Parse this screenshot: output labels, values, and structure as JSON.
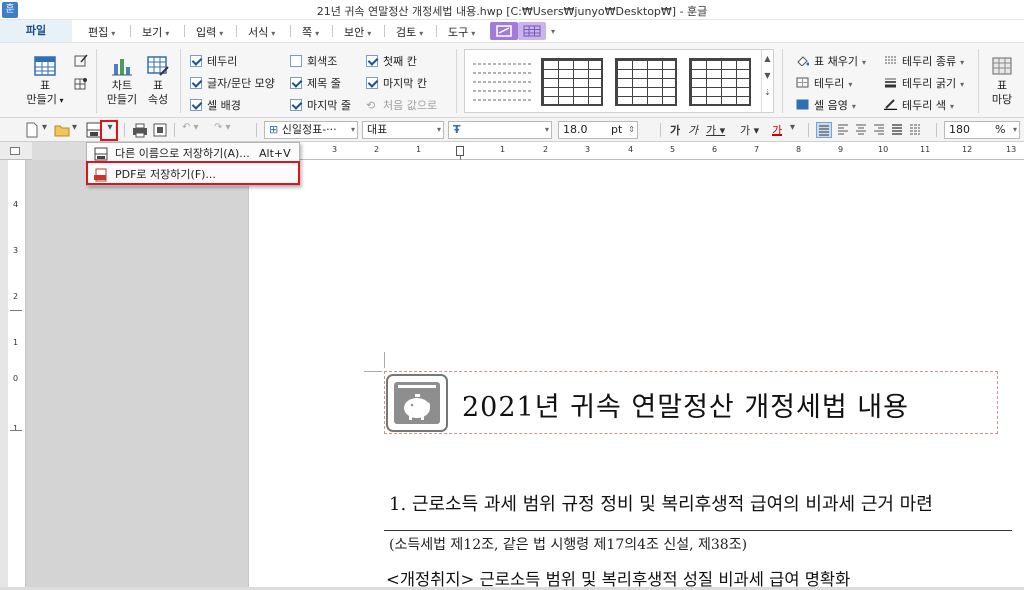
{
  "window": {
    "title": "21년 귀속 연말정산 개정세법 내용.hwp [C:₩Users₩junyo₩Desktop₩] - 훈글",
    "app_icon": "훈"
  },
  "menubar": {
    "file": "파일",
    "items": [
      "편집",
      "보기",
      "입력",
      "서식",
      "쪽",
      "보안",
      "검토",
      "도구"
    ]
  },
  "ribbon": {
    "table_make": [
      "표",
      "만들기"
    ],
    "chart_make": [
      "차트",
      "만들기"
    ],
    "table_props": [
      "표",
      "속성"
    ],
    "checks": [
      {
        "label": "테두리",
        "checked": true
      },
      {
        "label": "글자/문단 모양",
        "checked": true
      },
      {
        "label": "셀 배경",
        "checked": true
      },
      {
        "label": "회색조",
        "checked": false
      },
      {
        "label": "제목 줄",
        "checked": true
      },
      {
        "label": "마지막 줄",
        "checked": true
      },
      {
        "label": "첫째 칸",
        "checked": true
      },
      {
        "label": "마지막 칸",
        "checked": true
      },
      {
        "label": "처음 값으로",
        "checked": false
      }
    ],
    "right_col1": [
      "표 채우기",
      "테두리",
      "셀 음영"
    ],
    "right_col2": [
      "테두리 종류",
      "테두리 굵기",
      "테두리 색"
    ],
    "far_right": [
      "표",
      "마당"
    ]
  },
  "toolbar": {
    "style": "신일정표-···",
    "font_group": "대표",
    "font_name": "",
    "font_size": "18.0",
    "size_unit": "pt",
    "zoom": "180",
    "zoom_unit": "%"
  },
  "save_menu": {
    "items": [
      {
        "label": "다른 이름으로 저장하기(A)...",
        "shortcut": "Alt+V"
      },
      {
        "label": "PDF로 저장하기(F)...",
        "shortcut": ""
      }
    ]
  },
  "document": {
    "title": "2021년 귀속 연말정산 개정세법 내용",
    "heading1": "1. 근로소득 과세 범위 규정 정비 및 복리후생적 급여의 비과세 근거 마련",
    "para1": "(소득세법 제12조, 같은 법 시행령 제17의4조 신설, 제38조)",
    "para2": "<개정취지> 근로소득 범위 및 복리후생적 성질 비과세 급여 명확화"
  },
  "ruler": {
    "h_marks": [
      "3",
      "2",
      "1",
      "1",
      "2",
      "3",
      "4",
      "5",
      "6",
      "7",
      "8",
      "9",
      "10",
      "11",
      "12",
      "13"
    ],
    "v_marks": [
      "4",
      "3",
      "2",
      "1",
      "0",
      "1"
    ]
  },
  "colors": {
    "highlight_red": "#e0121c",
    "accent_blue": "#1a4f8b",
    "menu_badge": "#a07cd8"
  }
}
